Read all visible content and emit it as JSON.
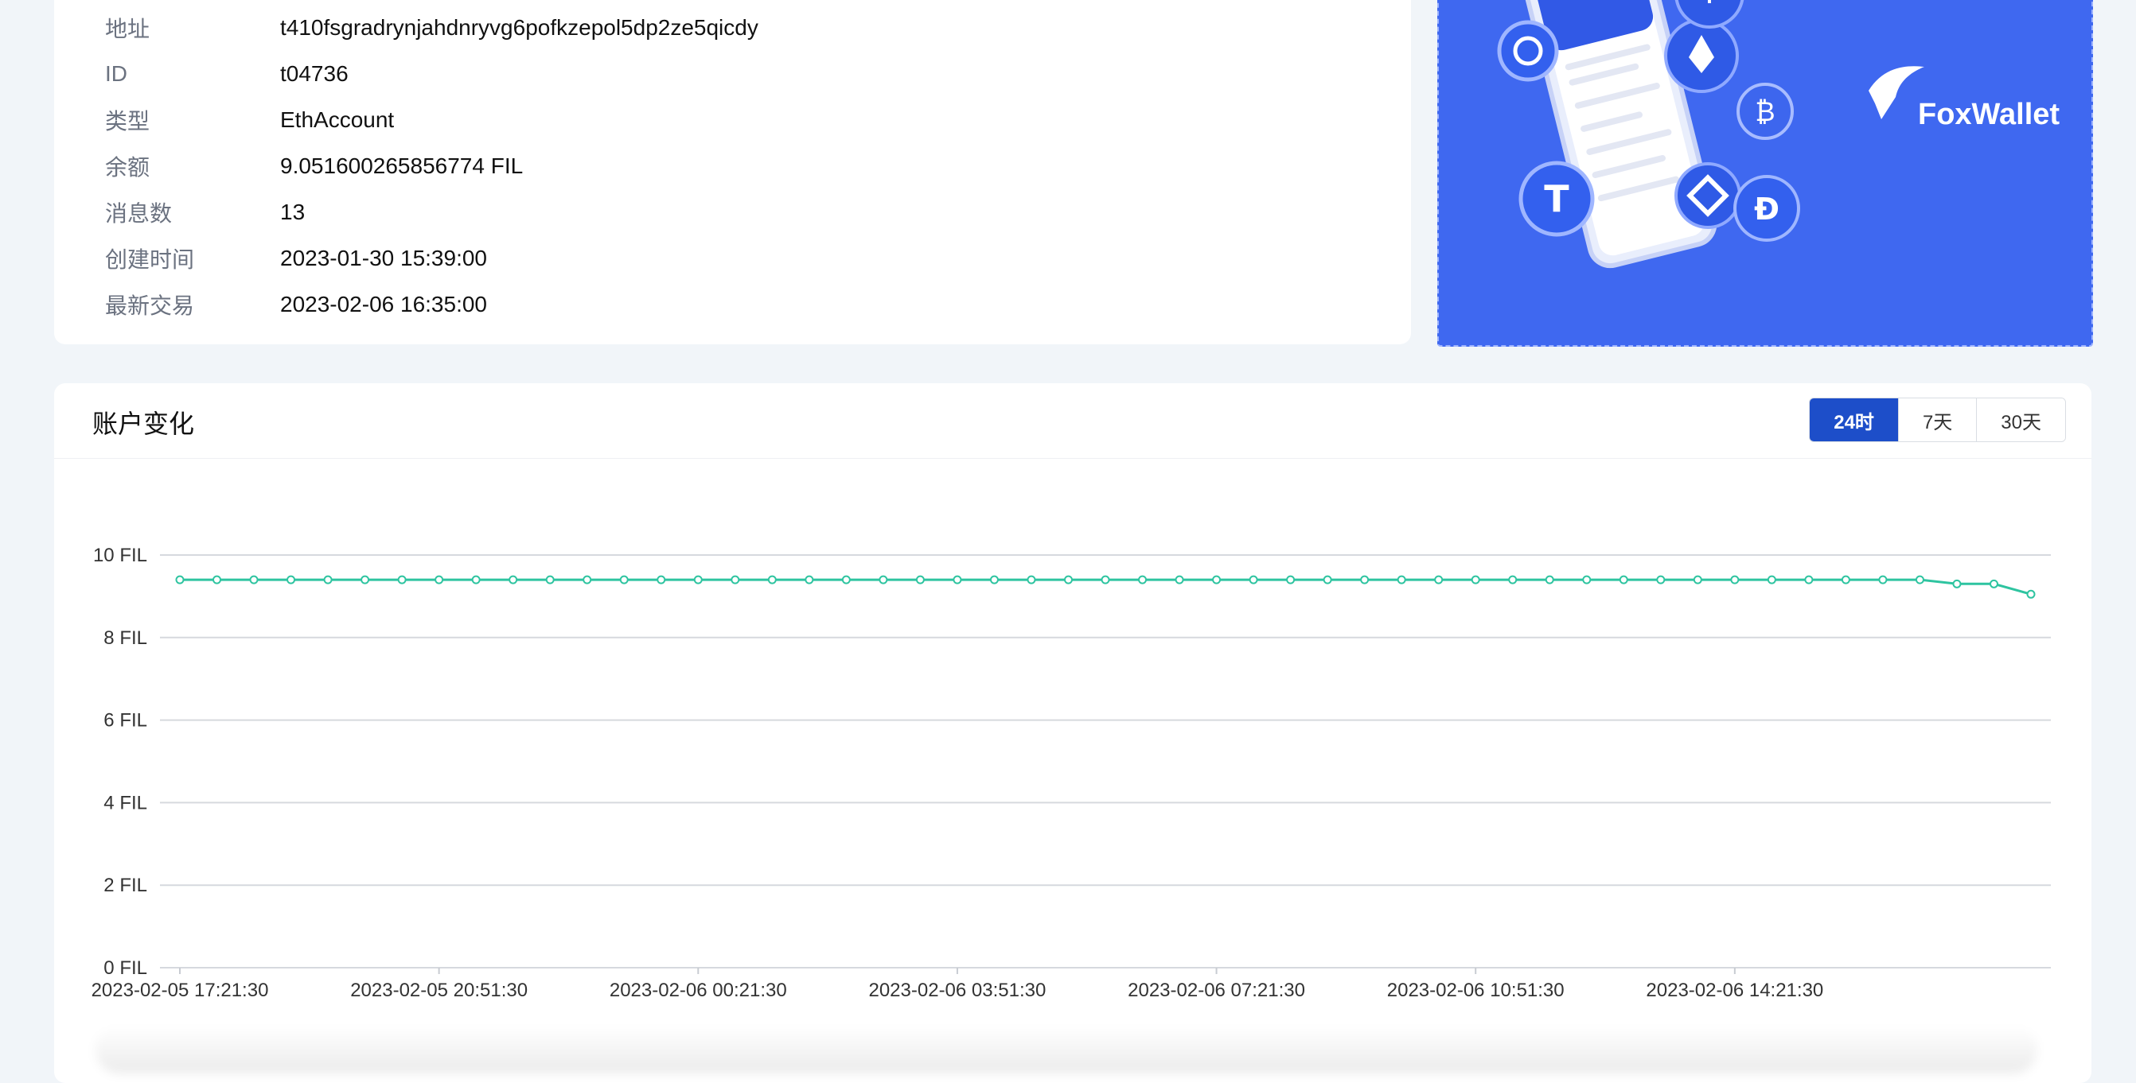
{
  "account": {
    "rows": [
      {
        "label": "地址",
        "value": "t410fsgradrynjahdnryvg6pofkzepol5dp2ze5qicdy"
      },
      {
        "label": "ID",
        "value": "t04736"
      },
      {
        "label": "类型",
        "value": "EthAccount"
      },
      {
        "label": "余额",
        "value": "9.051600265856774 FIL"
      },
      {
        "label": "消息数",
        "value": "13"
      },
      {
        "label": "创建时间",
        "value": "2023-01-30 15:39:00"
      },
      {
        "label": "最新交易",
        "value": "2023-02-06 16:35:00"
      }
    ]
  },
  "ad": {
    "brand": "FoxWallet",
    "colors": {
      "background": "#3f68f0"
    }
  },
  "chart_panel": {
    "title": "账户变化",
    "ranges": [
      {
        "label": "24时",
        "active": true
      },
      {
        "label": "7天",
        "active": false
      },
      {
        "label": "30天",
        "active": false
      }
    ]
  },
  "colors": {
    "accent": "#1d4ec9",
    "series": "#2ec4a0"
  },
  "chart_data": {
    "type": "line",
    "title": "",
    "xlabel": "",
    "ylabel": "",
    "ylim": [
      0,
      10
    ],
    "y_ticks": [
      "0 FIL",
      "2 FIL",
      "4 FIL",
      "6 FIL",
      "8 FIL",
      "10 FIL"
    ],
    "x_ticks": [
      "2023-02-05 17:21:30",
      "2023-02-05 20:51:30",
      "2023-02-06 00:21:30",
      "2023-02-06 03:51:30",
      "2023-02-06 07:21:30",
      "2023-02-06 10:51:30",
      "2023-02-06 14:21:30"
    ],
    "grid": true,
    "series": [
      {
        "values": [
          9.4,
          9.4,
          9.4,
          9.4,
          9.4,
          9.4,
          9.4,
          9.4,
          9.4,
          9.4,
          9.4,
          9.4,
          9.4,
          9.4,
          9.4,
          9.4,
          9.4,
          9.4,
          9.4,
          9.4,
          9.4,
          9.4,
          9.4,
          9.4,
          9.4,
          9.4,
          9.4,
          9.4,
          9.4,
          9.4,
          9.4,
          9.4,
          9.4,
          9.4,
          9.4,
          9.4,
          9.4,
          9.4,
          9.4,
          9.4,
          9.4,
          9.4,
          9.4,
          9.4,
          9.4,
          9.4,
          9.4,
          9.4,
          9.3,
          9.3,
          9.05
        ]
      }
    ]
  }
}
